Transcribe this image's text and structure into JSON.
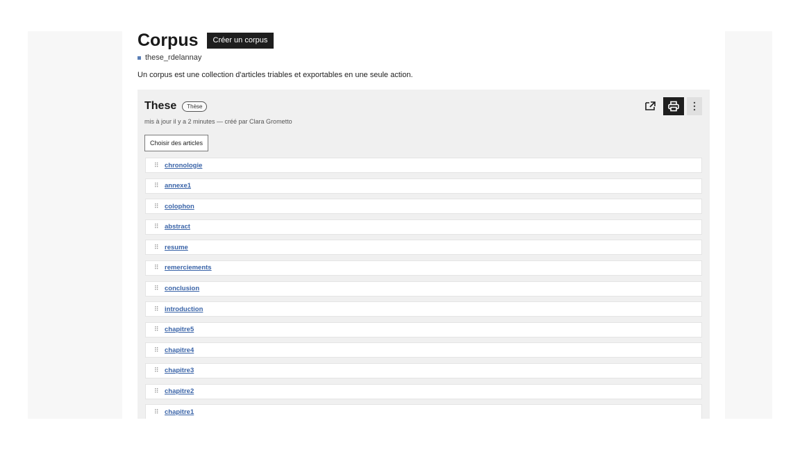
{
  "page": {
    "title": "Corpus",
    "create_label": "Créer un corpus",
    "owner": "these_rdelannay",
    "description": "Un corpus est une collection d'articles triables et exportables en une seule action."
  },
  "corpus": {
    "title": "These",
    "type_badge": "Thèse",
    "meta": "mis à jour il y a 2 minutes — créé par Clara Grometto",
    "choose_label": "Choisir des articles",
    "actions": {
      "export_icon": "share-export-icon",
      "print_icon": "printer-icon",
      "more_icon": "vertical-dots-icon"
    },
    "handle_glyph": "⠿",
    "articles": [
      "chronologie",
      "annexe1",
      "colophon",
      "abstract",
      "resume",
      "remerciements",
      "conclusion",
      "introduction",
      "chapitre5",
      "chapitre4",
      "chapitre3",
      "chapitre2",
      "chapitre1"
    ]
  },
  "colors": {
    "accent_link": "#3a64a8",
    "button_dark": "#1e1e1e",
    "card_bg": "#f0f0f0",
    "owner_marker": "#5b7fb6"
  }
}
